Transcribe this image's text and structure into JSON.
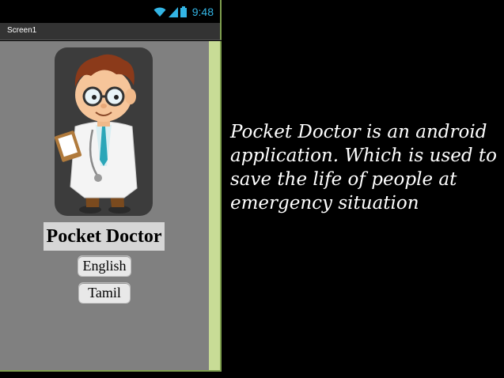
{
  "status_bar": {
    "time": "9:48",
    "icons": [
      "wifi-icon",
      "signal-icon",
      "battery-icon"
    ]
  },
  "title_bar": {
    "title": "Screen1"
  },
  "app": {
    "name": "Pocket Doctor",
    "buttons": {
      "english": "English",
      "tamil": "Tamil"
    },
    "image": "doctor-cartoon"
  },
  "description": "Pocket Doctor is an android application. Which is used to save the life of people at emergency situation",
  "colors": {
    "accent": "#33b5e5",
    "screen_bg": "#808080",
    "frame_green": "#7f9f4f",
    "scroll_strip": "#c8dc96"
  }
}
